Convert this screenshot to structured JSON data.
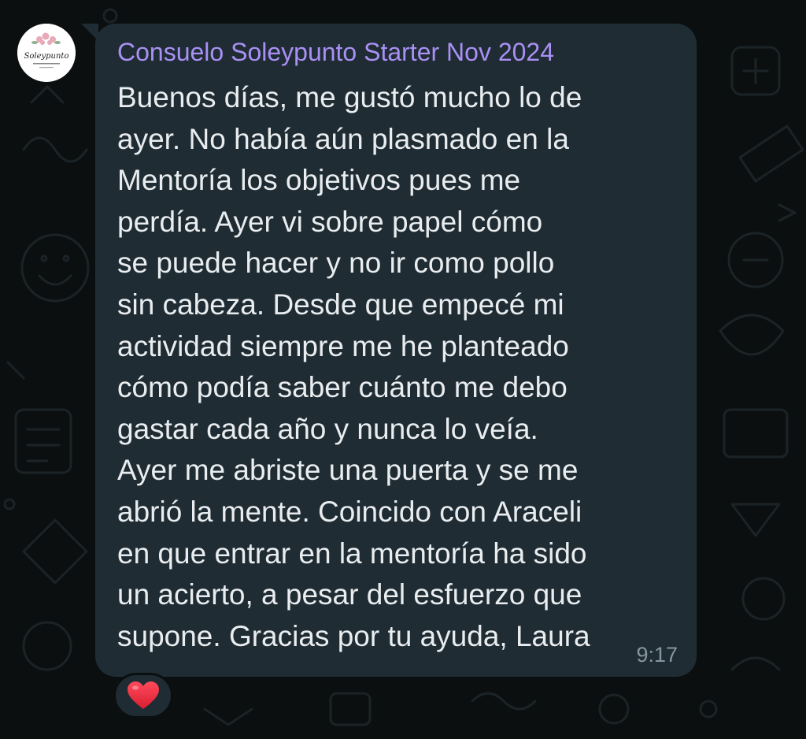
{
  "chat": {
    "sender_name": "Consuelo Soleypunto Starter Nov 2024",
    "avatar": {
      "logo_text": "Soleypunto"
    },
    "message_lines": [
      "Buenos días, me gustó mucho lo de",
      "ayer. No había aún plasmado en la",
      "Mentoría los objetivos pues me",
      "perdía. Ayer vi sobre papel cómo",
      "se puede hacer y no ir como pollo",
      "sin cabeza. Desde que empecé mi",
      "actividad siempre me he planteado",
      "cómo podía saber cuánto me debo",
      "gastar cada año y nunca lo veía.",
      "Ayer me abriste una puerta y se me",
      "abrió la mente. Coincido con Araceli",
      "en que entrar en la mentoría ha sido",
      "un acierto, a pesar del esfuerzo que",
      "supone. Gracias por tu ayuda, Laura"
    ],
    "time": "9:17",
    "reaction": "heart-icon"
  },
  "colors": {
    "background": "#0b0f10",
    "bubble": "#1f2c34",
    "sender_name": "#a990f4",
    "message_text": "#e9edef",
    "timestamp": "#8696a0",
    "reaction_heart": "#e8283c"
  }
}
